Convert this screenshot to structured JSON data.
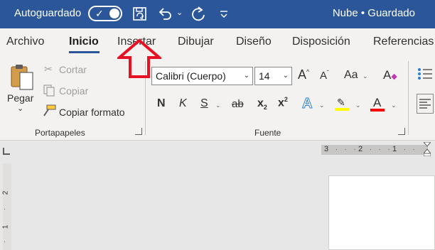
{
  "title_bar": {
    "autosave_label": "Autoguardado",
    "status": "Nube • Guardado"
  },
  "tabs": [
    "Archivo",
    "Inicio",
    "Insertar",
    "Dibujar",
    "Diseño",
    "Disposición",
    "Referencias"
  ],
  "clipboard": {
    "paste_label": "Pegar",
    "cut_label": "Cortar",
    "copy_label": "Copiar",
    "format_painter_label": "Copiar formato",
    "group_label": "Portapapeles"
  },
  "font": {
    "font_name": "Calibri (Cuerpo)",
    "font_size": "14",
    "bold": "N",
    "italic": "K",
    "underline": "S",
    "strike": "ab",
    "subscript": "x",
    "superscript": "x",
    "change_case": "Aa",
    "group_label": "Fuente"
  },
  "ruler": {
    "h_labels": [
      "3",
      "2",
      "1"
    ],
    "v_labels": [
      "2",
      "1"
    ]
  },
  "colors": {
    "title_bar": "#2b579a",
    "highlight": "#ffff00",
    "font_color": "#ff0000",
    "arrow": "#e81123"
  }
}
